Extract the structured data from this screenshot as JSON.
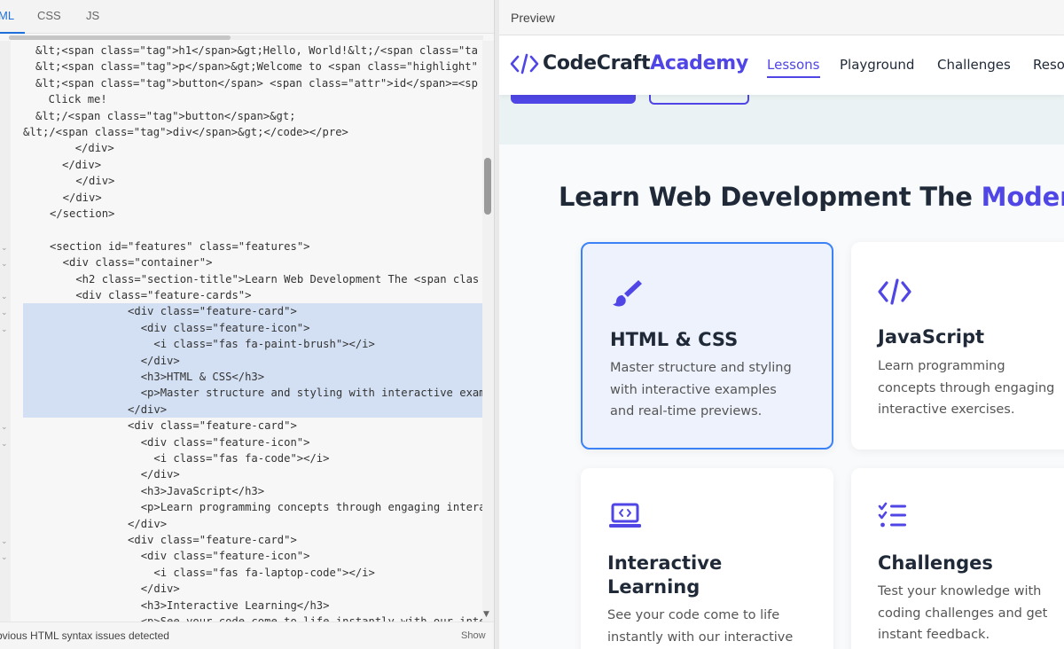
{
  "editor": {
    "tabs": [
      {
        "label": "HTML",
        "visible_label": "ML"
      },
      {
        "label": "CSS"
      },
      {
        "label": "JS"
      }
    ],
    "code_lines": [
      {
        "text": "&lt;<span class=\"tag\">h1</span>&gt;Hello, World!&lt;/<span class=\"ta",
        "indent": 3,
        "selected": false
      },
      {
        "text": "&lt;<span class=\"tag\">p</span>&gt;Welcome to <span class=\"highlight\"",
        "indent": 3,
        "selected": false
      },
      {
        "text": "&lt;<span class=\"tag\">button</span> <span class=\"attr\">id</span>=<sp",
        "indent": 3,
        "selected": false
      },
      {
        "text": "  Click me!",
        "indent": 3,
        "selected": false
      },
      {
        "text": "&lt;/<span class=\"tag\">button</span>&gt;",
        "indent": 3,
        "selected": false
      },
      {
        "text": "&lt;/<span class=\"tag\">div</span>&gt;</code></pre>",
        "indent": 1,
        "selected": false
      },
      {
        "text": "        </div>",
        "indent": 1,
        "selected": false
      },
      {
        "text": "      </div>",
        "indent": 1,
        "selected": false
      },
      {
        "text": "    </div>",
        "indent": 2,
        "selected": false
      },
      {
        "text": "  </div>",
        "indent": 2,
        "selected": false
      },
      {
        "text": "</section>",
        "indent": 2,
        "selected": false
      },
      {
        "text": "",
        "indent": 0,
        "selected": false
      },
      {
        "text": "<section id=\"features\" class=\"features\">",
        "indent": 2,
        "selected": false
      },
      {
        "text": "  <div class=\"container\">",
        "indent": 2,
        "selected": false
      },
      {
        "text": "    <h2 class=\"section-title\">Learn Web Development The <span clas",
        "indent": 2,
        "selected": false
      },
      {
        "text": "    <div class=\"feature-cards\">",
        "indent": 2,
        "selected": false
      },
      {
        "text": "      <div class=\"feature-card\">",
        "indent": 1,
        "selected": true
      },
      {
        "text": "        <div class=\"feature-icon\">",
        "indent": 1,
        "selected": true
      },
      {
        "text": "          <i class=\"fas fa-paint-brush\"></i>",
        "indent": 1,
        "selected": true
      },
      {
        "text": "        </div>",
        "indent": 1,
        "selected": true
      },
      {
        "text": "        <h3>HTML & CSS</h3>",
        "indent": 1,
        "selected": true
      },
      {
        "text": "        <p>Master structure and styling with interactive examples a",
        "indent": 1,
        "selected": true
      },
      {
        "text": "      </div>",
        "indent": 1,
        "selected": true
      },
      {
        "text": "      <div class=\"feature-card\">",
        "indent": 1,
        "selected": false
      },
      {
        "text": "        <div class=\"feature-icon\">",
        "indent": 1,
        "selected": false
      },
      {
        "text": "          <i class=\"fas fa-code\"></i>",
        "indent": 1,
        "selected": false
      },
      {
        "text": "        </div>",
        "indent": 1,
        "selected": false
      },
      {
        "text": "        <h3>JavaScript</h3>",
        "indent": 1,
        "selected": false
      },
      {
        "text": "        <p>Learn programming concepts through engaging interactive ",
        "indent": 1,
        "selected": false
      },
      {
        "text": "      </div>",
        "indent": 1,
        "selected": false
      },
      {
        "text": "      <div class=\"feature-card\">",
        "indent": 1,
        "selected": false
      },
      {
        "text": "        <div class=\"feature-icon\">",
        "indent": 1,
        "selected": false
      },
      {
        "text": "          <i class=\"fas fa-laptop-code\"></i>",
        "indent": 1,
        "selected": false
      },
      {
        "text": "        </div>",
        "indent": 1,
        "selected": false
      },
      {
        "text": "        <h3>Interactive Learning</h3>",
        "indent": 1,
        "selected": false
      },
      {
        "text": "        <p>See your code come to life instantly with our interacti",
        "indent": 1,
        "selected": false
      }
    ],
    "status_message": "bvious HTML syntax issues detected",
    "status_action": "Show"
  },
  "preview": {
    "title": "Preview",
    "site": {
      "logo_primary": "CodeCraft",
      "logo_accent": "Academy",
      "nav": [
        "Lessons",
        "Playground",
        "Challenges",
        "Reso"
      ],
      "active_nav": "Lessons"
    },
    "section_title_main": "Learn Web Development The ",
    "section_title_accent": "Modern",
    "cards": [
      {
        "icon": "paint-brush-icon",
        "title": "HTML & CSS",
        "desc_lines": [
          "Master structure and styling",
          "with interactive examples",
          "and real-time previews."
        ]
      },
      {
        "icon": "code-icon",
        "title": "JavaScript",
        "desc_lines": [
          "Learn programming",
          "concepts through engaging",
          "interactive exercises."
        ]
      },
      {
        "icon": "laptop-code-icon",
        "title_lines": [
          "Interactive",
          "Learning"
        ],
        "desc_lines": [
          "See your code come to life",
          "instantly with our interactive"
        ]
      },
      {
        "icon": "tasks-icon",
        "title": "Challenges",
        "desc_lines": [
          "Test your knowledge with",
          "coding challenges and get",
          "instant feedback."
        ]
      }
    ]
  },
  "colors": {
    "accent": "#4f46e5",
    "active_border": "#3b82f6",
    "selection": "#d3e0f3",
    "tag": "#b22a2a",
    "string": "#1a8a1a"
  }
}
